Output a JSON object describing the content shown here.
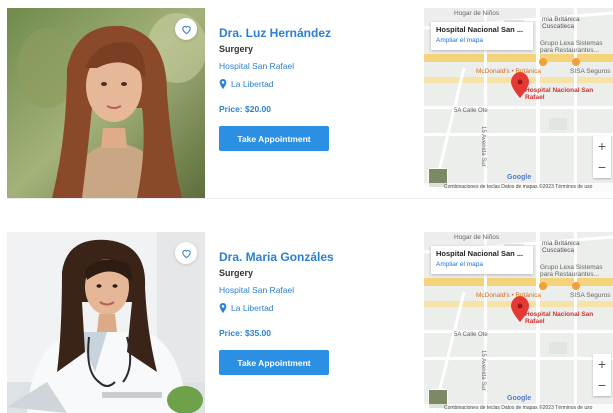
{
  "doctors": [
    {
      "name": "Dra. Luz Hernández",
      "specialty": "Surgery",
      "hospital": "Hospital San Rafael",
      "location": "La Libertad",
      "price": "Price: $20.00",
      "button": "Take Appointment"
    },
    {
      "name": "Dra. Maria Gonzáles",
      "specialty": "Surgery",
      "hospital": "Hospital San Rafael",
      "location": "La Libertad",
      "price": "Price: $35.00",
      "button": "Take Appointment"
    }
  ],
  "map": {
    "place_title": "Hospital Nacional San ...",
    "enlarge_link": "Ampliar el mapa",
    "labels": {
      "top_left": "Hogar de Niños",
      "top_right": "mia Británica Cuscatleca",
      "grupo": "Grupo Lexa Sistemas para Restaurantes...",
      "mcd": "McDonald's • Británica",
      "sisa": "SISA Seguros",
      "hospital": "Hospital Nacional San Rafael",
      "street1": "5A Calle Ote",
      "street2": "15 Avenida Sur"
    },
    "zoom_in": "+",
    "zoom_out": "−",
    "google": "Google",
    "attribution": "Combinaciones de teclas   Datos de mapas ©2023   Términos de uso"
  },
  "colors": {
    "accent": "#2b80d5",
    "button": "#2b8fe3",
    "pin": "#e53935"
  }
}
